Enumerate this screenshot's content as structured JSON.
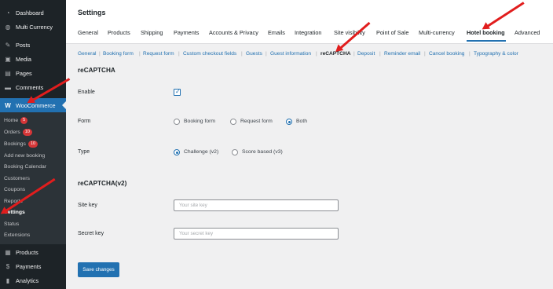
{
  "sidebar": {
    "items": [
      {
        "label": "Dashboard",
        "icon": "dashboard-icon"
      },
      {
        "label": "Multi Currency",
        "icon": "globe-icon"
      },
      {
        "label": "Posts",
        "icon": "pin-icon"
      },
      {
        "label": "Media",
        "icon": "media-icon"
      },
      {
        "label": "Pages",
        "icon": "pages-icon"
      },
      {
        "label": "Comments",
        "icon": "comments-icon"
      },
      {
        "label": "WooCommerce",
        "icon": "woocommerce-icon"
      },
      {
        "label": "Products",
        "icon": "products-icon"
      },
      {
        "label": "Payments",
        "icon": "payments-icon"
      },
      {
        "label": "Analytics",
        "icon": "analytics-icon"
      }
    ],
    "submenu": [
      {
        "label": "Home",
        "badge": "5"
      },
      {
        "label": "Orders",
        "badge": "10"
      },
      {
        "label": "Bookings",
        "badge": "10"
      },
      {
        "label": "Add new booking"
      },
      {
        "label": "Booking Calendar"
      },
      {
        "label": "Customers"
      },
      {
        "label": "Coupons"
      },
      {
        "label": "Reports"
      },
      {
        "label": "Settings"
      },
      {
        "label": "Status"
      },
      {
        "label": "Extensions"
      }
    ]
  },
  "header": {
    "title": "Settings",
    "tabs": [
      "General",
      "Products",
      "Shipping",
      "Payments",
      "Accounts & Privacy",
      "Emails",
      "Integration",
      "Site visibility",
      "Point of Sale",
      "Multi-currency",
      "Hotel booking",
      "Advanced"
    ],
    "active_tab": "Hotel booking"
  },
  "subsub": [
    "General",
    "Booking form",
    "Request form",
    "Custom checkout fields",
    "Guests",
    "Guest information",
    "reCAPTCHA",
    "Deposit",
    "Reminder email",
    "Cancel booking",
    "Typography & color"
  ],
  "subsub_current": "reCAPTCHA",
  "form": {
    "section_title": "reCAPTCHA",
    "enable_label": "Enable",
    "enable_checked": true,
    "form_label": "Form",
    "form_options": [
      "Booking form",
      "Request form",
      "Both"
    ],
    "form_selected": "Both",
    "type_label": "Type",
    "type_options": [
      "Challenge (v2)",
      "Score based (v3)"
    ],
    "type_selected": "Challenge (v2)",
    "section2_title": "reCAPTCHA(v2)",
    "site_key_label": "Site key",
    "site_key_placeholder": "Your site key",
    "site_key_value": "",
    "secret_key_label": "Secret key",
    "secret_key_placeholder": "Your secret key",
    "secret_key_value": "",
    "save_label": "Save changes"
  },
  "colors": {
    "accent": "#2271b1",
    "sidebar": "#1d2327",
    "annotation_arrow": "#e11d1d",
    "badge": "#d63638"
  }
}
